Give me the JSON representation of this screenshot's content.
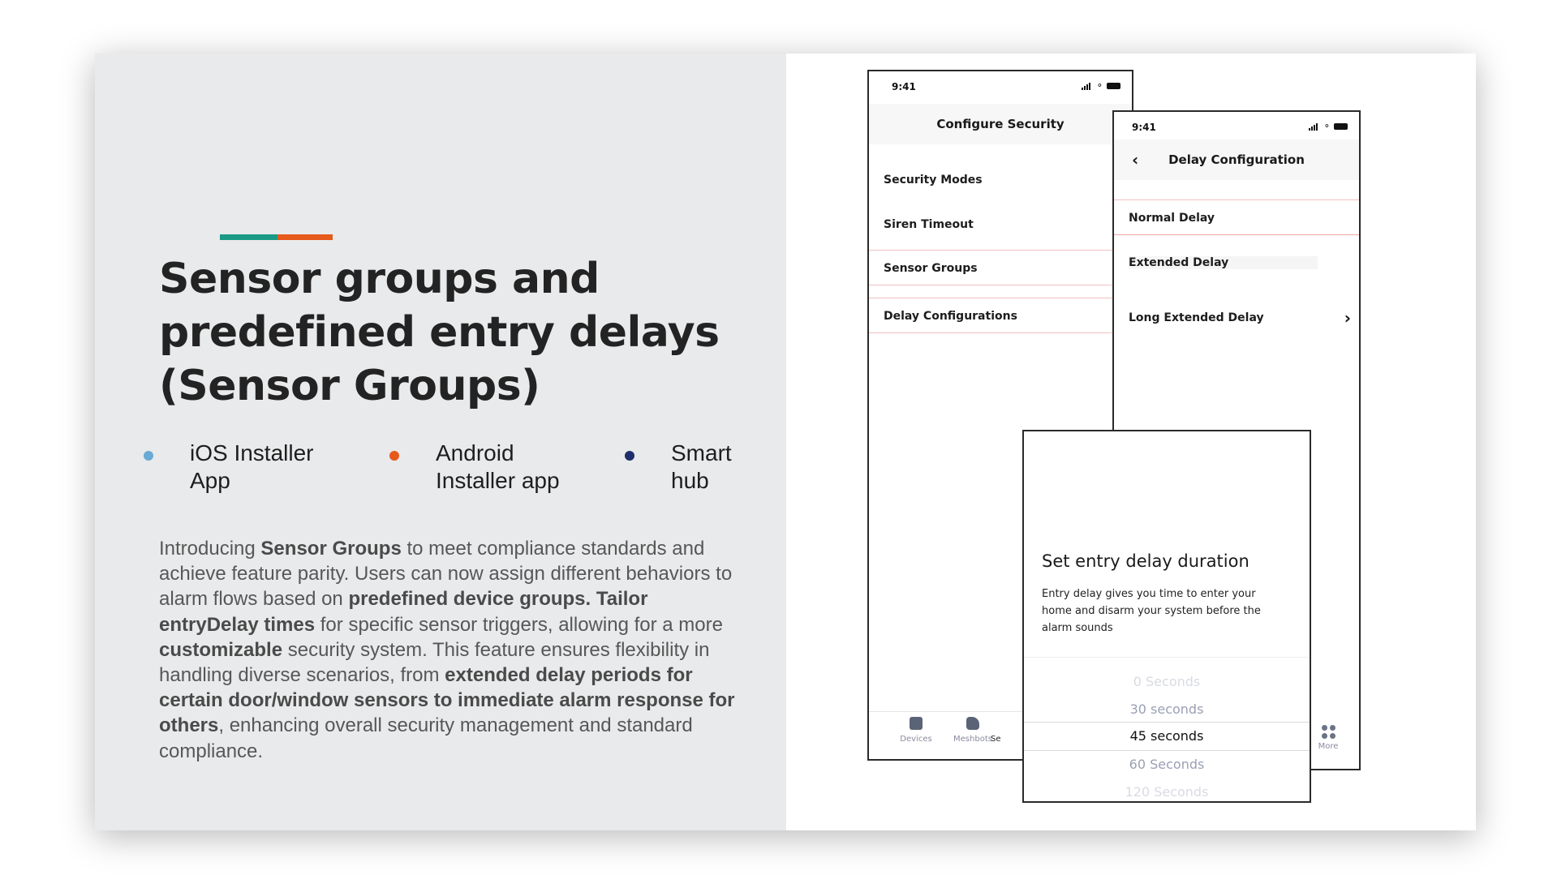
{
  "slide": {
    "title": "Sensor groups and predefined entry delays (Sensor Groups)",
    "accent_colors": [
      "#1a9a86",
      "#e65a1b"
    ],
    "bullets": [
      {
        "label": "iOS Installer App",
        "color": "#6aaad4"
      },
      {
        "label": "Android Installer app",
        "color": "#e65a1b"
      },
      {
        "label": "Smart hub",
        "color": "#1f2f6b"
      }
    ],
    "body": {
      "t1": "Introducing ",
      "b1": "Sensor Groups",
      "t2": " to meet compliance standards and achieve feature parity. Users can now assign different behaviors to alarm flows based on ",
      "b2": "predefined device groups. Tailor entryDelay times",
      "t3": " for specific sensor triggers, allowing for a more ",
      "b3": "customizable",
      "t4": " security system. This feature ensures flexibility in handling diverse scenarios, from ",
      "b4": "extended delay periods for certain door/window sensors to immediate alarm response for others",
      "t5": ", enhancing overall security management and standard compliance."
    }
  },
  "phone1": {
    "time": "9:41",
    "header": "Configure Security",
    "items": [
      "Security Modes",
      "Siren Timeout",
      "Sensor Groups",
      "Delay Configurations"
    ],
    "nav": [
      "Devices",
      "Meshbots",
      "Se"
    ]
  },
  "phone2": {
    "time": "9:41",
    "header": "Delay Configuration",
    "items": [
      "Normal Delay",
      "Extended Delay",
      "Long Extended Delay"
    ],
    "nav_more": "More"
  },
  "modal": {
    "title": "Set entry delay duration",
    "description": "Entry delay gives you time to enter your home and disarm your system before the alarm sounds",
    "options": [
      "0 Seconds",
      "30 seconds",
      "45 seconds",
      "60 Seconds",
      "120 Seconds"
    ],
    "selected": "45 seconds"
  }
}
